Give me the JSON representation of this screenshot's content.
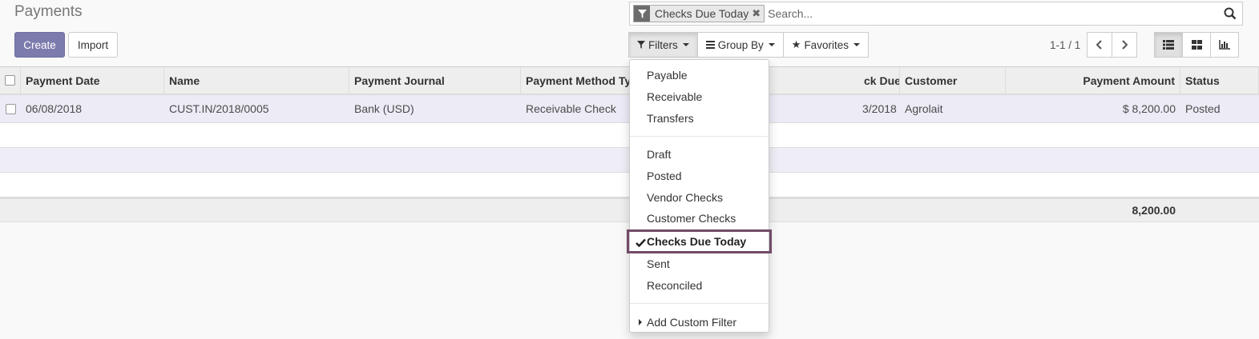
{
  "breadcrumb": {
    "title": "Payments"
  },
  "buttons": {
    "create": "Create",
    "import": "Import"
  },
  "search": {
    "facet_label": "Checks Due Today",
    "placeholder": "Search..."
  },
  "search_buttons": {
    "filters": "Filters",
    "group_by": "Group By",
    "favorites": "Favorites"
  },
  "pager": {
    "value": "1-1 / 1"
  },
  "table": {
    "columns": [
      "Payment Date",
      "Name",
      "Payment Journal",
      "Payment Method Ty",
      "ck Due Date",
      "Customer",
      "Payment Amount",
      "Status"
    ],
    "rows": [
      {
        "date": "06/08/2018",
        "name": "CUST.IN/2018/0005",
        "journal": "Bank (USD)",
        "method": "Receivable Check",
        "due": "3/2018",
        "customer": "Agrolait",
        "amount": "$ 8,200.00",
        "status": "Posted"
      }
    ],
    "total": "8,200.00"
  },
  "filters_menu": {
    "group1": [
      "Payable",
      "Receivable",
      "Transfers"
    ],
    "group2": [
      "Draft",
      "Posted",
      "Vendor Checks",
      "Customer Checks",
      "Checks Due Today",
      "Sent",
      "Reconciled"
    ],
    "selected": "Checks Due Today",
    "custom": "Add Custom Filter"
  },
  "colors": {
    "primary": "#7c7bad",
    "highlight": "#714b67",
    "row_selected": "#ecebf6"
  }
}
